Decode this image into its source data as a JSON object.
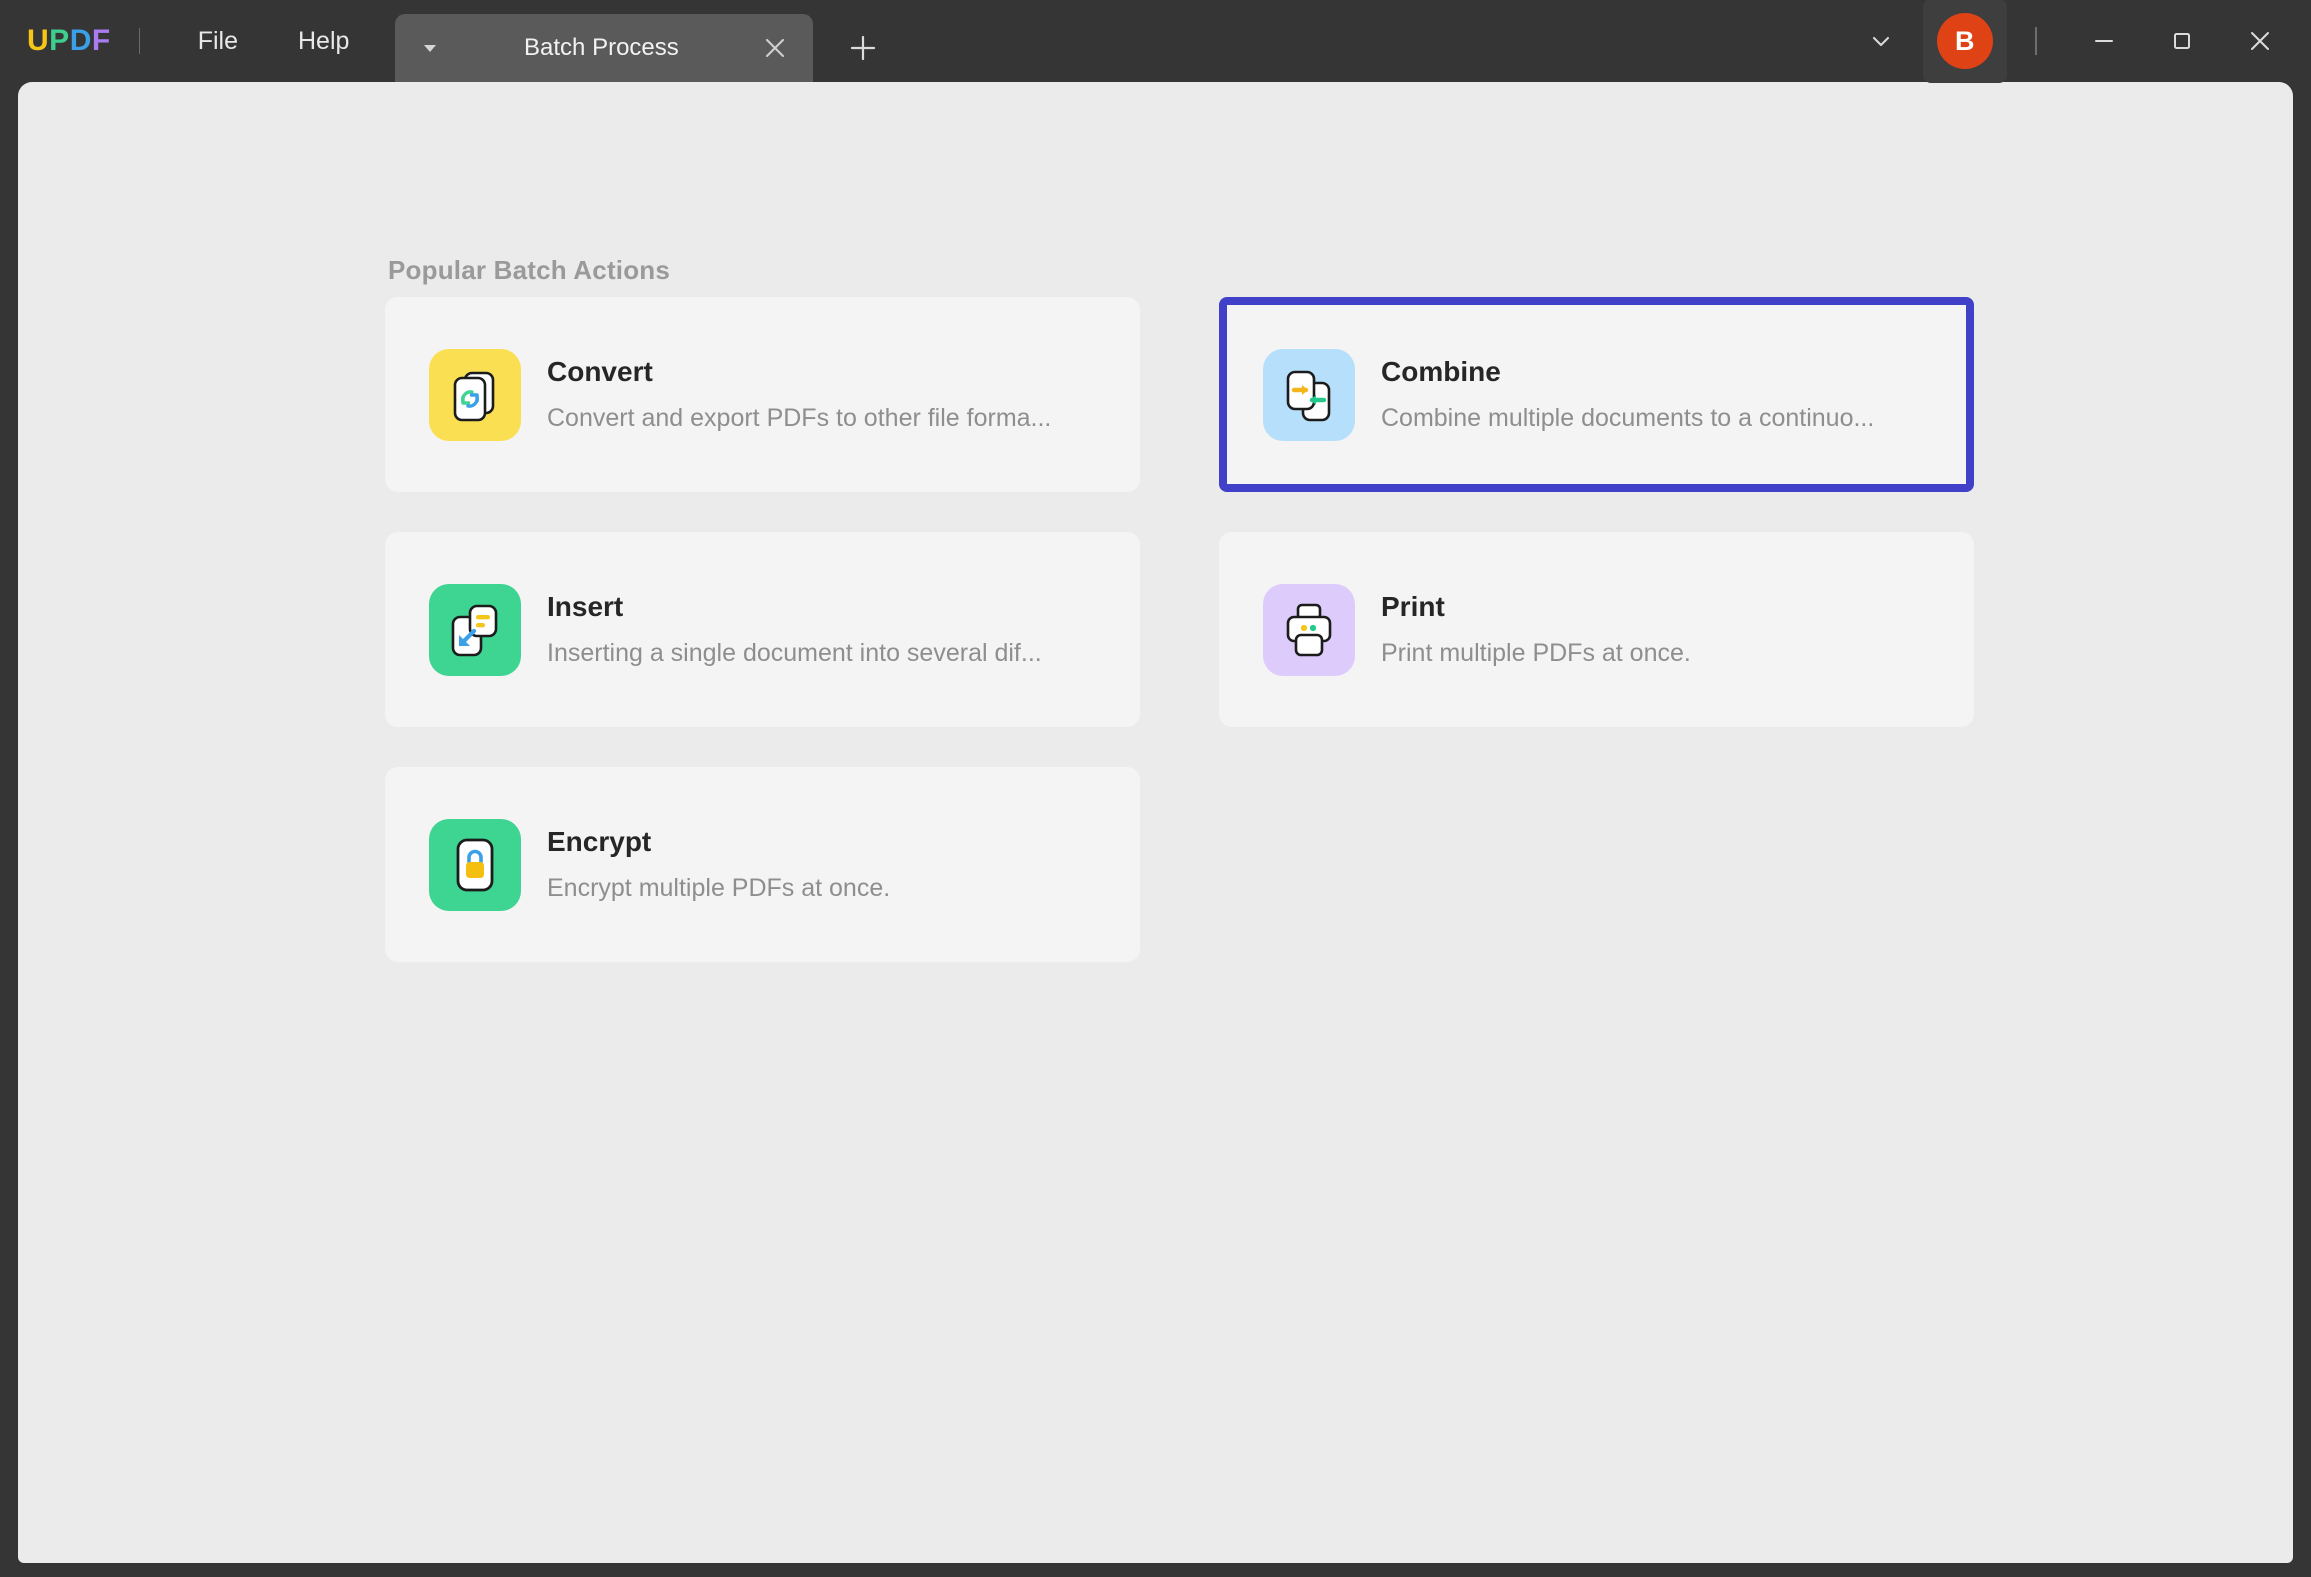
{
  "window": {
    "brand": {
      "letters": [
        {
          "char": "U",
          "color": "#f5c518"
        },
        {
          "char": "P",
          "color": "#3ecf8e"
        },
        {
          "char": "D",
          "color": "#3aa0e8"
        },
        {
          "char": "F",
          "color": "#a97df0"
        }
      ]
    },
    "menu": [
      {
        "label": "File",
        "name": "menu-file"
      },
      {
        "label": "Help",
        "name": "menu-help"
      }
    ],
    "tabs": [
      {
        "label": "Batch Process",
        "active": true
      }
    ],
    "new_tab_label": "+",
    "account": {
      "initial": "B",
      "color": "#df4215"
    },
    "controls": {
      "chevron": "chevron-down",
      "minimize": "minimize",
      "maximize": "maximize",
      "close": "close"
    }
  },
  "main": {
    "section_title": "Popular Batch Actions",
    "cards": [
      {
        "id": "convert",
        "title": "Convert",
        "description": "Convert and export PDFs to other file forma...",
        "icon_name": "convert-icon",
        "icon_bg": "#fbdf52",
        "selected": false
      },
      {
        "id": "combine",
        "title": "Combine",
        "description": "Combine multiple documents to a continuo...",
        "icon_name": "combine-icon",
        "icon_bg": "#b6dffb",
        "selected": true
      },
      {
        "id": "insert",
        "title": "Insert",
        "description": "Inserting a single document into several dif...",
        "icon_name": "insert-icon",
        "icon_bg": "#3ed492",
        "selected": false
      },
      {
        "id": "print",
        "title": "Print",
        "description": "Print multiple PDFs at once.",
        "icon_name": "print-icon",
        "icon_bg": "#ddcbfb",
        "selected": false
      },
      {
        "id": "encrypt",
        "title": "Encrypt",
        "description": "Encrypt multiple PDFs at once.",
        "icon_name": "encrypt-icon",
        "icon_bg": "#3ed492",
        "selected": false
      }
    ]
  },
  "colors": {
    "titlebar_bg": "#353535",
    "tab_active_bg": "#5a5a5a",
    "content_bg": "#ebebeb",
    "card_bg": "#f4f4f4",
    "selection_border": "#4040c8",
    "title_text": "#262626",
    "desc_text": "#8e8e8e",
    "section_title_text": "#9a9a9a"
  }
}
